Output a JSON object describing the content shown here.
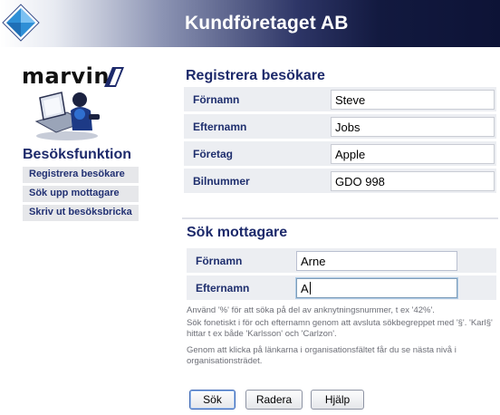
{
  "header": {
    "title": "Kundföretaget AB",
    "logo_icon": "blue-diamond-icon",
    "gradient_dark": "#0d1336"
  },
  "sidebar": {
    "brand": "marvin",
    "brand_icon": "person-at-computer-icon",
    "section_title": "Besöksfunktion",
    "items": [
      {
        "label": "Registrera besökare"
      },
      {
        "label": "Sök upp mottagare"
      },
      {
        "label": "Skriv ut besöksbricka"
      }
    ]
  },
  "register": {
    "title": "Registrera besökare",
    "fields": [
      {
        "label": "Förnamn",
        "value": "Steve"
      },
      {
        "label": "Efternamn",
        "value": "Jobs"
      },
      {
        "label": "Företag",
        "value": "Apple"
      },
      {
        "label": "Bilnummer",
        "value": "GDO 998"
      }
    ]
  },
  "search": {
    "title": "Sök mottagare",
    "fields": [
      {
        "label": "Förnamn",
        "value": "Arne"
      },
      {
        "label": "Efternamn",
        "value": "A"
      }
    ],
    "help": [
      "Använd '%' för att söka på del av anknytningsnummer, t ex '42%'.",
      "Sök fonetiskt i för och efternamn genom att avsluta sökbegreppet med '§'. 'Karl§' hittar t ex både 'Karlsson' och 'Carlzon'.",
      "Genom att klicka på länkarna i organisationsfältet får du se nästa nivå i organisationsträdet."
    ]
  },
  "buttons": {
    "search": "Sök",
    "clear": "Radera",
    "help": "Hjälp"
  },
  "colors": {
    "accent": "#1d2a6b",
    "label_bg": "#eceef2",
    "logo_blue": "#2f8fd6"
  }
}
